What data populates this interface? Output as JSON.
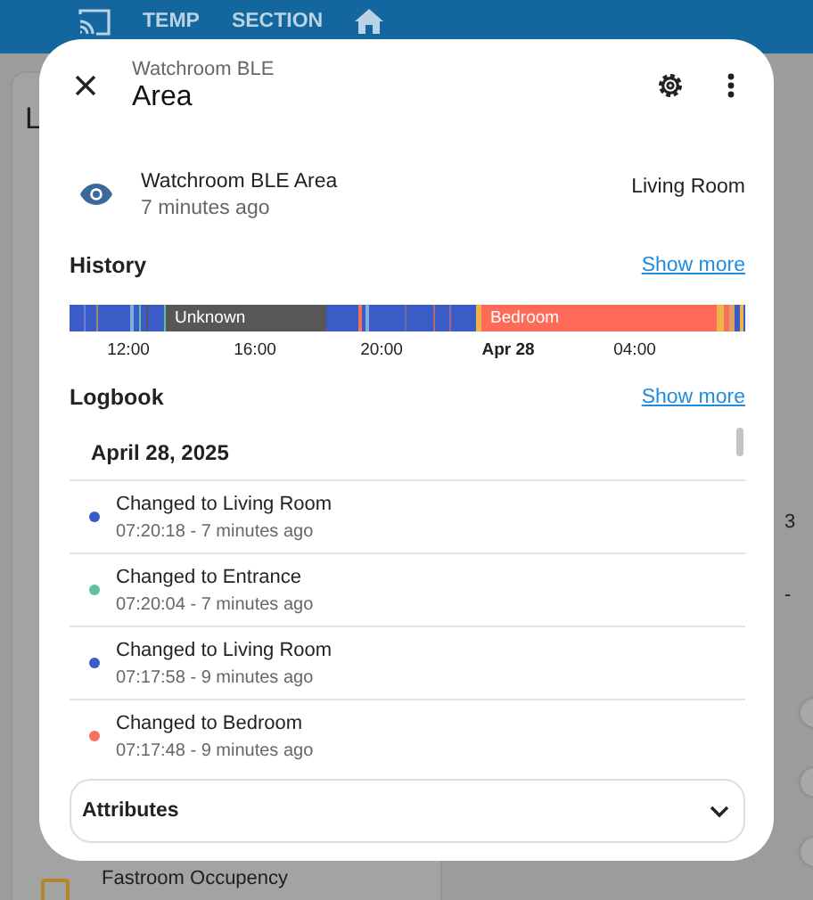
{
  "background": {
    "top_bar": {
      "items": [
        "TEMP",
        "SECTION"
      ]
    },
    "left_card": {
      "title": "L",
      "row": {
        "name": "Fastroom Occupency"
      }
    },
    "right_column": [
      "3",
      "-"
    ],
    "toggles": [
      {
        "on": false
      },
      {
        "on": false
      },
      {
        "on": false
      }
    ]
  },
  "dialog": {
    "subtitle": "Watchroom BLE",
    "title": "Area",
    "entity": {
      "name": "Watchroom BLE Area",
      "changed": "7 minutes ago",
      "state": "Living Room"
    },
    "history": {
      "heading": "History",
      "link": "Show more",
      "segments": [
        {
          "label": "Unknown"
        },
        {
          "label": "Bedroom"
        }
      ],
      "ticks": [
        {
          "label": "12:00",
          "bold": false
        },
        {
          "label": "16:00",
          "bold": false
        },
        {
          "label": "20:00",
          "bold": false
        },
        {
          "label": "Apr 28",
          "bold": true
        },
        {
          "label": "04:00",
          "bold": false
        }
      ]
    },
    "logbook": {
      "heading": "Logbook",
      "link": "Show more",
      "date": "April 28, 2025",
      "entries": [
        {
          "title": "Changed to Living Room",
          "time": "07:20:18 - 7 minutes ago",
          "color": "#3b5bc6"
        },
        {
          "title": "Changed to Entrance",
          "time": "07:20:04 - 7 minutes ago",
          "color": "#5fc0a2"
        },
        {
          "title": "Changed to Living Room",
          "time": "07:17:58 - 9 minutes ago",
          "color": "#3b5bc6"
        },
        {
          "title": "Changed to Bedroom",
          "time": "07:17:48 - 9 minutes ago",
          "color": "#f4725c"
        }
      ]
    },
    "attributes": {
      "label": "Attributes",
      "expanded": false
    }
  }
}
